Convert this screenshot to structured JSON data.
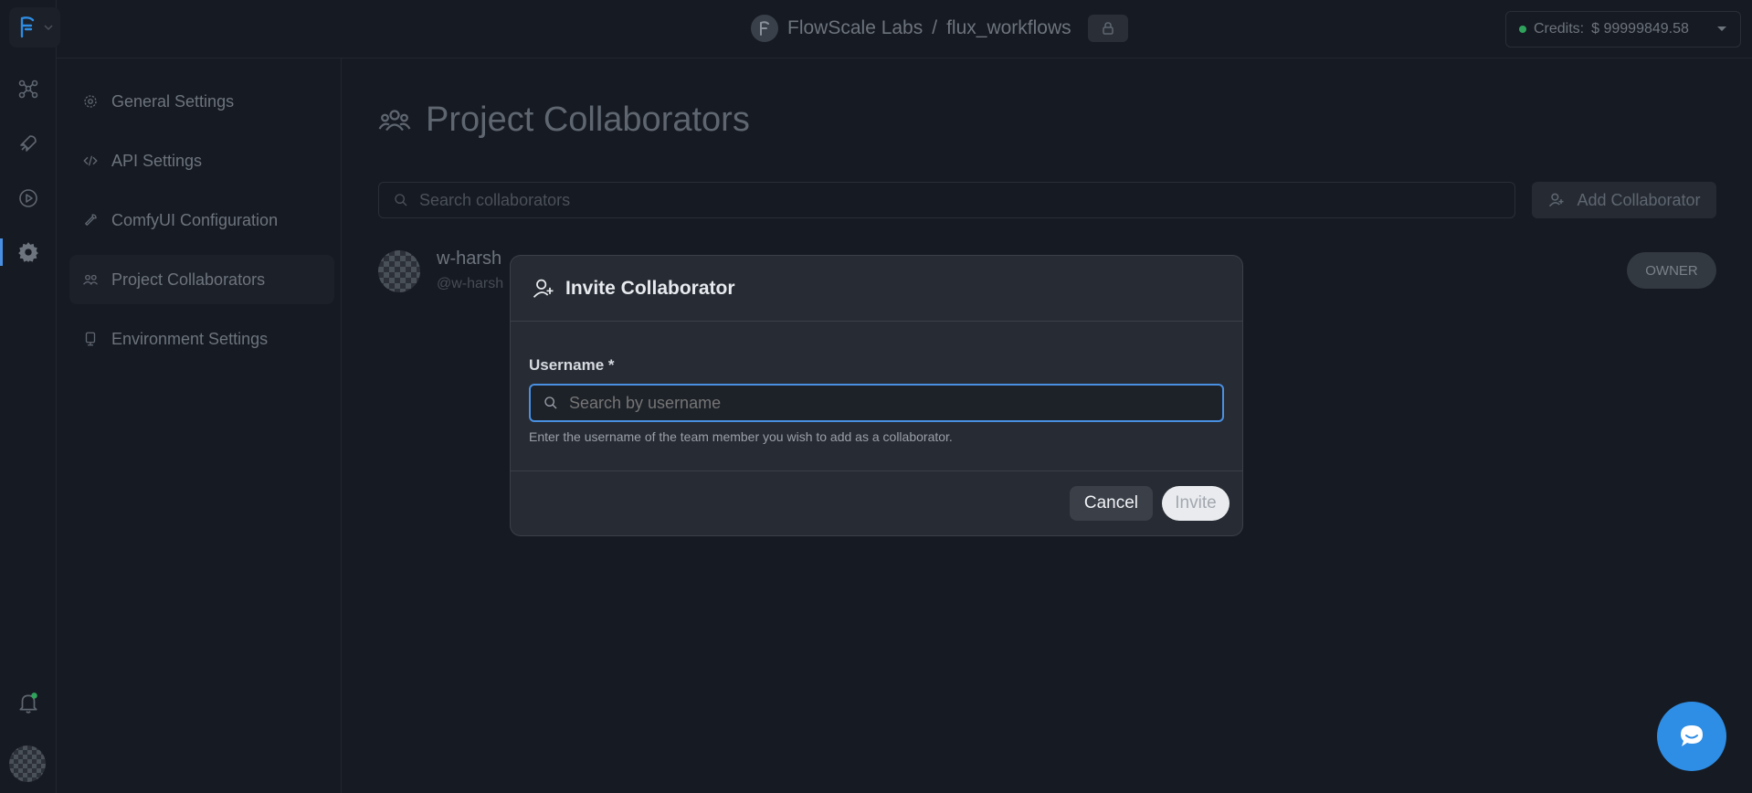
{
  "topbar": {
    "org": "FlowScale Labs",
    "separator": "/",
    "project": "flux_workflows",
    "credits_label": "Credits:",
    "credits_value": "$ 99999849.58"
  },
  "sidebar": {
    "items": [
      {
        "label": "General Settings",
        "icon": "gear-icon"
      },
      {
        "label": "API Settings",
        "icon": "code-icon"
      },
      {
        "label": "ComfyUI Configuration",
        "icon": "wrench-icon"
      },
      {
        "label": "Project Collaborators",
        "icon": "users-icon"
      },
      {
        "label": "Environment Settings",
        "icon": "server-icon"
      }
    ]
  },
  "main": {
    "title": "Project Collaborators",
    "search_placeholder": "Search collaborators",
    "add_button": "Add Collaborator",
    "collaborators": [
      {
        "name": "w-harsh",
        "handle": "@w-harsh",
        "role": "OWNER"
      }
    ]
  },
  "modal": {
    "title": "Invite Collaborator",
    "field_label": "Username *",
    "input_placeholder": "Search by username",
    "input_value": "",
    "help_text": "Enter the username of the team member you wish to add as a collaborator.",
    "cancel": "Cancel",
    "invite": "Invite"
  },
  "colors": {
    "accent": "#4a90e2",
    "chat_button": "#2e8de4",
    "status_online": "#2fa35c"
  }
}
